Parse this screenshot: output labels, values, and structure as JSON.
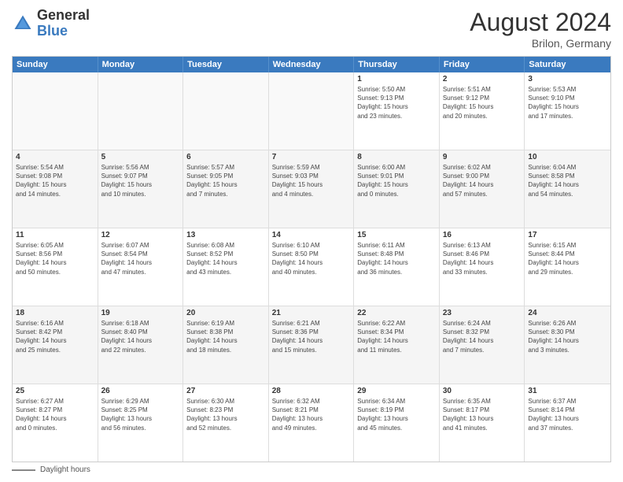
{
  "header": {
    "logo": {
      "general": "General",
      "blue": "Blue"
    },
    "month_year": "August 2024",
    "location": "Brilon, Germany"
  },
  "days_of_week": [
    "Sunday",
    "Monday",
    "Tuesday",
    "Wednesday",
    "Thursday",
    "Friday",
    "Saturday"
  ],
  "footer": {
    "daylight_label": "Daylight hours"
  },
  "weeks": [
    {
      "cells": [
        {
          "day": "",
          "info": "",
          "empty": true
        },
        {
          "day": "",
          "info": "",
          "empty": true
        },
        {
          "day": "",
          "info": "",
          "empty": true
        },
        {
          "day": "",
          "info": "",
          "empty": true
        },
        {
          "day": "1",
          "info": "Sunrise: 5:50 AM\nSunset: 9:13 PM\nDaylight: 15 hours\nand 23 minutes.",
          "empty": false
        },
        {
          "day": "2",
          "info": "Sunrise: 5:51 AM\nSunset: 9:12 PM\nDaylight: 15 hours\nand 20 minutes.",
          "empty": false
        },
        {
          "day": "3",
          "info": "Sunrise: 5:53 AM\nSunset: 9:10 PM\nDaylight: 15 hours\nand 17 minutes.",
          "empty": false
        }
      ]
    },
    {
      "cells": [
        {
          "day": "4",
          "info": "Sunrise: 5:54 AM\nSunset: 9:08 PM\nDaylight: 15 hours\nand 14 minutes.",
          "empty": false
        },
        {
          "day": "5",
          "info": "Sunrise: 5:56 AM\nSunset: 9:07 PM\nDaylight: 15 hours\nand 10 minutes.",
          "empty": false
        },
        {
          "day": "6",
          "info": "Sunrise: 5:57 AM\nSunset: 9:05 PM\nDaylight: 15 hours\nand 7 minutes.",
          "empty": false
        },
        {
          "day": "7",
          "info": "Sunrise: 5:59 AM\nSunset: 9:03 PM\nDaylight: 15 hours\nand 4 minutes.",
          "empty": false
        },
        {
          "day": "8",
          "info": "Sunrise: 6:00 AM\nSunset: 9:01 PM\nDaylight: 15 hours\nand 0 minutes.",
          "empty": false
        },
        {
          "day": "9",
          "info": "Sunrise: 6:02 AM\nSunset: 9:00 PM\nDaylight: 14 hours\nand 57 minutes.",
          "empty": false
        },
        {
          "day": "10",
          "info": "Sunrise: 6:04 AM\nSunset: 8:58 PM\nDaylight: 14 hours\nand 54 minutes.",
          "empty": false
        }
      ]
    },
    {
      "cells": [
        {
          "day": "11",
          "info": "Sunrise: 6:05 AM\nSunset: 8:56 PM\nDaylight: 14 hours\nand 50 minutes.",
          "empty": false
        },
        {
          "day": "12",
          "info": "Sunrise: 6:07 AM\nSunset: 8:54 PM\nDaylight: 14 hours\nand 47 minutes.",
          "empty": false
        },
        {
          "day": "13",
          "info": "Sunrise: 6:08 AM\nSunset: 8:52 PM\nDaylight: 14 hours\nand 43 minutes.",
          "empty": false
        },
        {
          "day": "14",
          "info": "Sunrise: 6:10 AM\nSunset: 8:50 PM\nDaylight: 14 hours\nand 40 minutes.",
          "empty": false
        },
        {
          "day": "15",
          "info": "Sunrise: 6:11 AM\nSunset: 8:48 PM\nDaylight: 14 hours\nand 36 minutes.",
          "empty": false
        },
        {
          "day": "16",
          "info": "Sunrise: 6:13 AM\nSunset: 8:46 PM\nDaylight: 14 hours\nand 33 minutes.",
          "empty": false
        },
        {
          "day": "17",
          "info": "Sunrise: 6:15 AM\nSunset: 8:44 PM\nDaylight: 14 hours\nand 29 minutes.",
          "empty": false
        }
      ]
    },
    {
      "cells": [
        {
          "day": "18",
          "info": "Sunrise: 6:16 AM\nSunset: 8:42 PM\nDaylight: 14 hours\nand 25 minutes.",
          "empty": false
        },
        {
          "day": "19",
          "info": "Sunrise: 6:18 AM\nSunset: 8:40 PM\nDaylight: 14 hours\nand 22 minutes.",
          "empty": false
        },
        {
          "day": "20",
          "info": "Sunrise: 6:19 AM\nSunset: 8:38 PM\nDaylight: 14 hours\nand 18 minutes.",
          "empty": false
        },
        {
          "day": "21",
          "info": "Sunrise: 6:21 AM\nSunset: 8:36 PM\nDaylight: 14 hours\nand 15 minutes.",
          "empty": false
        },
        {
          "day": "22",
          "info": "Sunrise: 6:22 AM\nSunset: 8:34 PM\nDaylight: 14 hours\nand 11 minutes.",
          "empty": false
        },
        {
          "day": "23",
          "info": "Sunrise: 6:24 AM\nSunset: 8:32 PM\nDaylight: 14 hours\nand 7 minutes.",
          "empty": false
        },
        {
          "day": "24",
          "info": "Sunrise: 6:26 AM\nSunset: 8:30 PM\nDaylight: 14 hours\nand 3 minutes.",
          "empty": false
        }
      ]
    },
    {
      "cells": [
        {
          "day": "25",
          "info": "Sunrise: 6:27 AM\nSunset: 8:27 PM\nDaylight: 14 hours\nand 0 minutes.",
          "empty": false
        },
        {
          "day": "26",
          "info": "Sunrise: 6:29 AM\nSunset: 8:25 PM\nDaylight: 13 hours\nand 56 minutes.",
          "empty": false
        },
        {
          "day": "27",
          "info": "Sunrise: 6:30 AM\nSunset: 8:23 PM\nDaylight: 13 hours\nand 52 minutes.",
          "empty": false
        },
        {
          "day": "28",
          "info": "Sunrise: 6:32 AM\nSunset: 8:21 PM\nDaylight: 13 hours\nand 49 minutes.",
          "empty": false
        },
        {
          "day": "29",
          "info": "Sunrise: 6:34 AM\nSunset: 8:19 PM\nDaylight: 13 hours\nand 45 minutes.",
          "empty": false
        },
        {
          "day": "30",
          "info": "Sunrise: 6:35 AM\nSunset: 8:17 PM\nDaylight: 13 hours\nand 41 minutes.",
          "empty": false
        },
        {
          "day": "31",
          "info": "Sunrise: 6:37 AM\nSunset: 8:14 PM\nDaylight: 13 hours\nand 37 minutes.",
          "empty": false
        }
      ]
    }
  ]
}
